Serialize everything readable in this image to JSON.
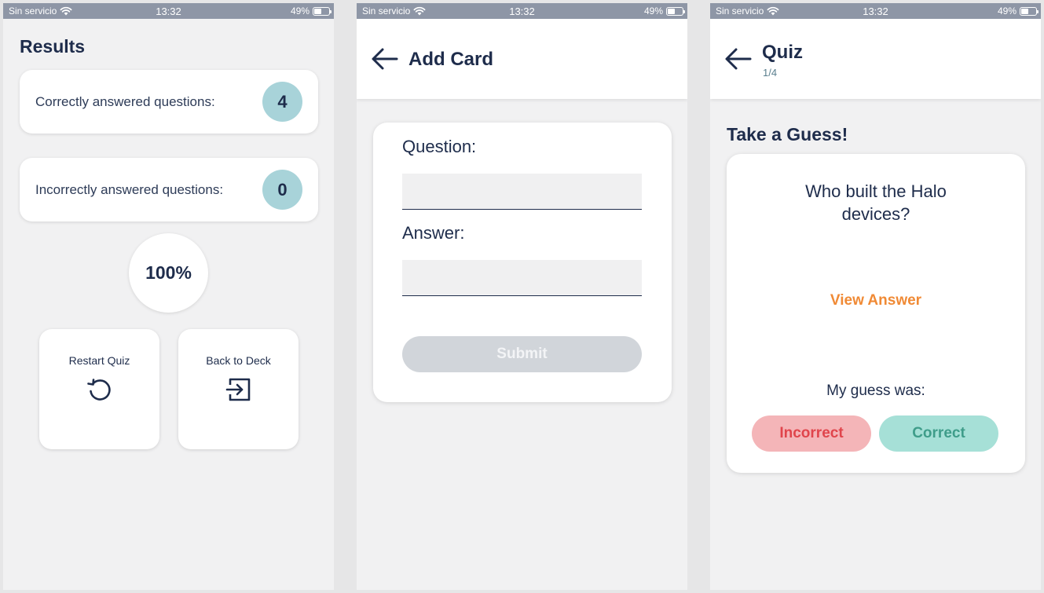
{
  "status_bar": {
    "carrier": "Sin servicio",
    "time": "13:32",
    "battery": "49%"
  },
  "results": {
    "title": "Results",
    "correct_label": "Correctly answered questions:",
    "correct_count": "4",
    "incorrect_label": "Incorrectly answered questions:",
    "incorrect_count": "0",
    "percentage": "100%",
    "restart_label": "Restart Quiz",
    "back_label": "Back to Deck",
    "icons": [
      "restart-icon",
      "exit-icon"
    ]
  },
  "add_card": {
    "title": "Add Card",
    "question_label": "Question:",
    "question_value": "",
    "answer_label": "Answer:",
    "answer_value": "",
    "submit_label": "Submit"
  },
  "quiz": {
    "title": "Quiz",
    "progress": "1/4",
    "prompt": "Take a Guess!",
    "question": "Who built the Halo devices?",
    "view_answer": "View Answer",
    "guess_label": "My guess was:",
    "incorrect_label": "Incorrect",
    "correct_label": "Correct"
  },
  "colors": {
    "navy": "#1e2c4b",
    "badge": "#a8d3d9",
    "accent_orange": "#f08a35",
    "incorrect_bg": "#f4b5b8",
    "incorrect_text": "#e0454c",
    "correct_bg": "#a6e0d7",
    "correct_text": "#3f9d8a",
    "statusbar": "#8e96a6"
  }
}
